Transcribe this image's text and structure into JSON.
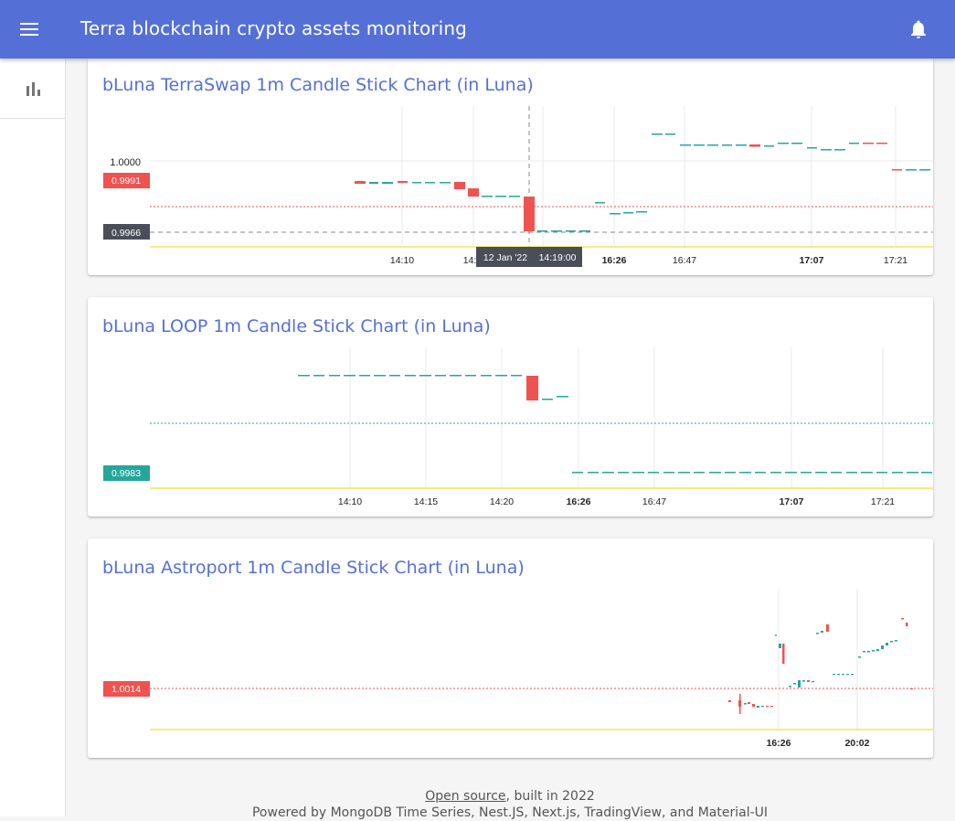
{
  "app": {
    "title": "Terra blockchain crypto assets monitoring",
    "menu_icon": "menu-icon",
    "notifications_icon": "bell-icon"
  },
  "sidebar": {
    "items": [
      {
        "icon": "bar-chart-icon"
      }
    ]
  },
  "colors": {
    "appbar": "#5470d6",
    "up": "#26a69a",
    "down": "#ef5350",
    "crosshair_label": "#4a4e59",
    "baseline": "#f2e132"
  },
  "charts": [
    {
      "title": "bLuna TerraSwap 1m Candle Stick Chart (in Luna)",
      "price_labels": [
        {
          "text": "1.0000",
          "kind": "plain"
        },
        {
          "text": "0.9991",
          "kind": "down"
        },
        {
          "text": "0.9966",
          "kind": "crosshair"
        }
      ],
      "time_ticks": [
        {
          "text": "14:10",
          "bold": false
        },
        {
          "text": "14:",
          "bold": false
        },
        {
          "text": "16:26",
          "bold": true
        },
        {
          "text": "16:47",
          "bold": false
        },
        {
          "text": "17:07",
          "bold": true
        },
        {
          "text": "17:21",
          "bold": false
        }
      ],
      "crosshair_time": {
        "date": "12 Jan '22",
        "time": "14:19:00"
      }
    },
    {
      "title": "bLuna LOOP 1m Candle Stick Chart (in Luna)",
      "price_labels": [
        {
          "text": "0.9983",
          "kind": "up"
        }
      ],
      "time_ticks": [
        {
          "text": "14:10",
          "bold": false
        },
        {
          "text": "14:15",
          "bold": false
        },
        {
          "text": "14:20",
          "bold": false
        },
        {
          "text": "16:26",
          "bold": true
        },
        {
          "text": "16:47",
          "bold": false
        },
        {
          "text": "17:07",
          "bold": true
        },
        {
          "text": "17:21",
          "bold": false
        }
      ]
    },
    {
      "title": "bLuna Astroport 1m Candle Stick Chart (in Luna)",
      "price_labels": [
        {
          "text": "1.0014",
          "kind": "down"
        }
      ],
      "time_ticks": [
        {
          "text": "16:26",
          "bold": true
        },
        {
          "text": "20:02",
          "bold": true
        }
      ]
    }
  ],
  "footer": {
    "link_text": "Open source",
    "built_text": ", built in 2022",
    "powered_text": "Powered by MongoDB Time Series, Nest.JS, Next.js, TradingView, and Material-UI"
  }
}
